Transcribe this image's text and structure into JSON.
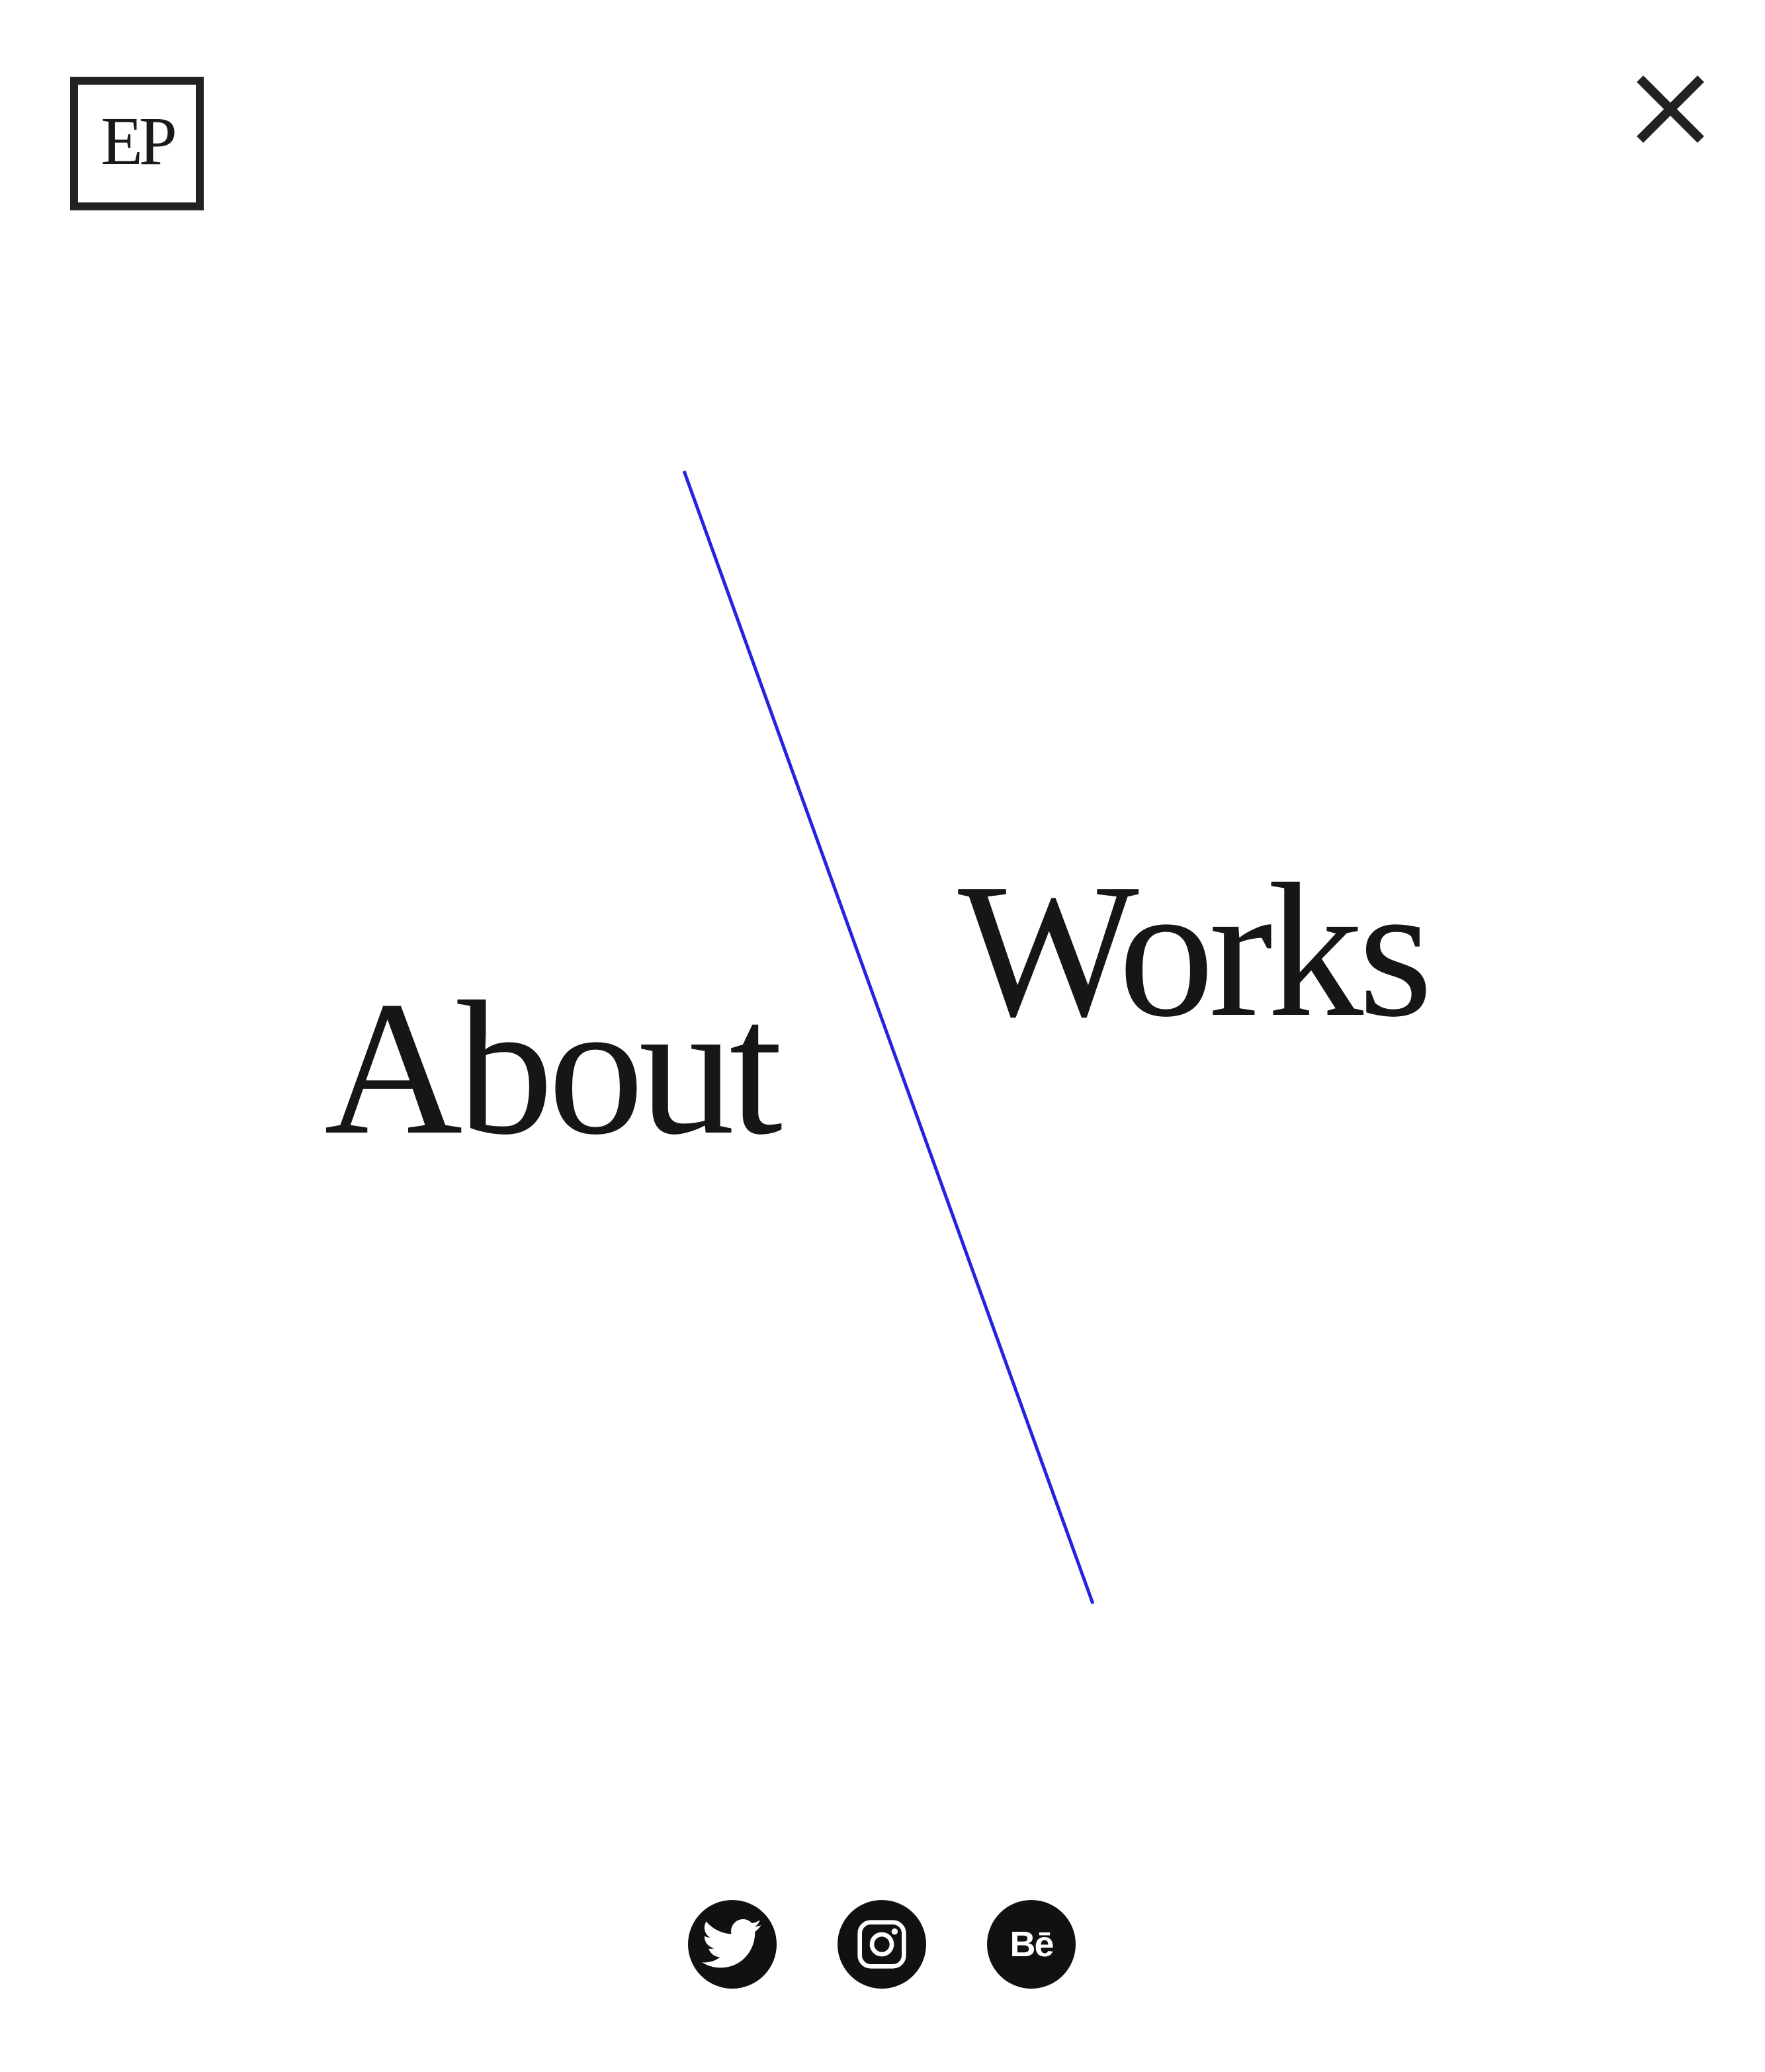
{
  "logo": {
    "text": "EP"
  },
  "header": {
    "close_icon": "close-icon"
  },
  "nav": {
    "about_label": "About",
    "works_label": "Works",
    "divider_color": "#2323e0"
  },
  "social": {
    "items": [
      {
        "name": "twitter",
        "icon": "twitter-bird-icon"
      },
      {
        "name": "instagram",
        "icon": "instagram-camera-icon"
      },
      {
        "name": "behance",
        "icon": "behance-icon",
        "text": "Bē"
      }
    ]
  },
  "colors": {
    "text": "#161616",
    "background": "#ffffff",
    "accent_line": "#2323e0"
  }
}
